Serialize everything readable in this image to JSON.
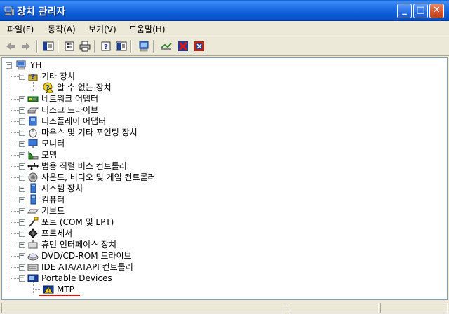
{
  "window": {
    "title": "장치 관리자"
  },
  "menu": [
    {
      "label": "파일(F)"
    },
    {
      "label": "동작(A)"
    },
    {
      "label": "보기(V)"
    },
    {
      "label": "도움말(H)"
    }
  ],
  "toolbar": {
    "icons": [
      "back-arrow-icon",
      "forward-arrow-icon",
      "console-tree-icon",
      "properties-icon",
      "print-icon",
      "help-icon",
      "show-hide-icon",
      "scan-hardware-icon",
      "update-driver-icon",
      "disable-device-icon",
      "uninstall-device-icon"
    ]
  },
  "tree": {
    "root": "YH",
    "items": [
      {
        "label": "기타 장치",
        "icon": "unknown-device-icon",
        "expanded": true
      },
      {
        "label": "알 수 없는 장치",
        "icon": "unknown-device-warning-icon",
        "child": true
      },
      {
        "label": "네트워크 어댑터",
        "icon": "network-adapter-icon"
      },
      {
        "label": "디스크 드라이브",
        "icon": "disk-drive-icon"
      },
      {
        "label": "디스플레이 어댑터",
        "icon": "display-adapter-icon"
      },
      {
        "label": "마우스 및 기타 포인팅 장치",
        "icon": "mouse-icon"
      },
      {
        "label": "모니터",
        "icon": "monitor-icon"
      },
      {
        "label": "모뎀",
        "icon": "modem-icon"
      },
      {
        "label": "범용 직렬 버스 컨트롤러",
        "icon": "usb-icon"
      },
      {
        "label": "사운드, 비디오 및 게임 컨트롤러",
        "icon": "sound-icon"
      },
      {
        "label": "시스템 장치",
        "icon": "system-device-icon"
      },
      {
        "label": "컴퓨터",
        "icon": "computer-icon"
      },
      {
        "label": "키보드",
        "icon": "keyboard-icon"
      },
      {
        "label": "포트 (COM 및 LPT)",
        "icon": "port-icon"
      },
      {
        "label": "프로세서",
        "icon": "processor-icon"
      },
      {
        "label": "휴먼 인터페이스 장치",
        "icon": "hid-icon"
      },
      {
        "label": "DVD/CD-ROM 드라이브",
        "icon": "cdrom-icon"
      },
      {
        "label": "IDE ATA/ATAPI 컨트롤러",
        "icon": "ide-icon"
      },
      {
        "label": "Portable Devices",
        "icon": "portable-device-icon",
        "expanded": true
      },
      {
        "label": "MTP",
        "icon": "mtp-warning-icon",
        "child": true
      }
    ]
  },
  "colors": {
    "titlebar": "#0a5fd8",
    "highlight": "#e8100a"
  }
}
